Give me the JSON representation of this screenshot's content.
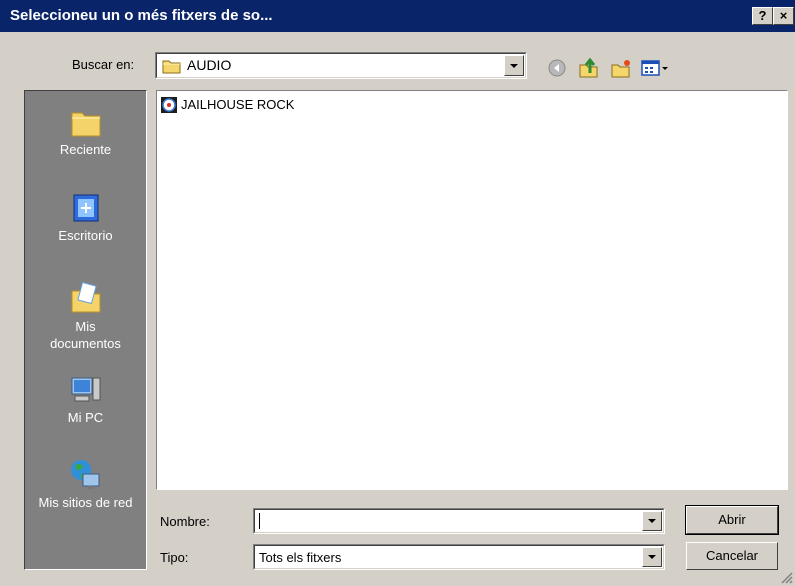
{
  "window": {
    "title": "Seleccioneu un o més fitxers de so...",
    "help_glyph": "?",
    "close_glyph": "×"
  },
  "toolbar": {
    "look_in_label": "Buscar en:",
    "look_in_value": "AUDIO",
    "icons": [
      "back-icon",
      "up-folder-icon",
      "new-folder-icon",
      "view-menu-icon"
    ]
  },
  "places": [
    {
      "label": "Reciente",
      "icon": "recent-folder-icon"
    },
    {
      "label": "Escritorio",
      "icon": "desktop-icon"
    },
    {
      "label": "Mis documentos",
      "icon": "my-documents-icon"
    },
    {
      "label": "Mi PC",
      "icon": "my-computer-icon"
    },
    {
      "label": "Mis sitios de red",
      "icon": "network-places-icon"
    }
  ],
  "files": [
    {
      "name": "JAILHOUSE ROCK",
      "icon": "audio-cd-file-icon"
    }
  ],
  "form": {
    "name_label": "Nombre:",
    "name_value": "",
    "type_label": "Tipo:",
    "type_value": "Tots els fitxers"
  },
  "buttons": {
    "open": "Abrir",
    "cancel": "Cancelar"
  },
  "colors": {
    "titlebar": "#0a246a",
    "dialog_bg": "#d4d0c8",
    "places_bg": "#808080"
  }
}
